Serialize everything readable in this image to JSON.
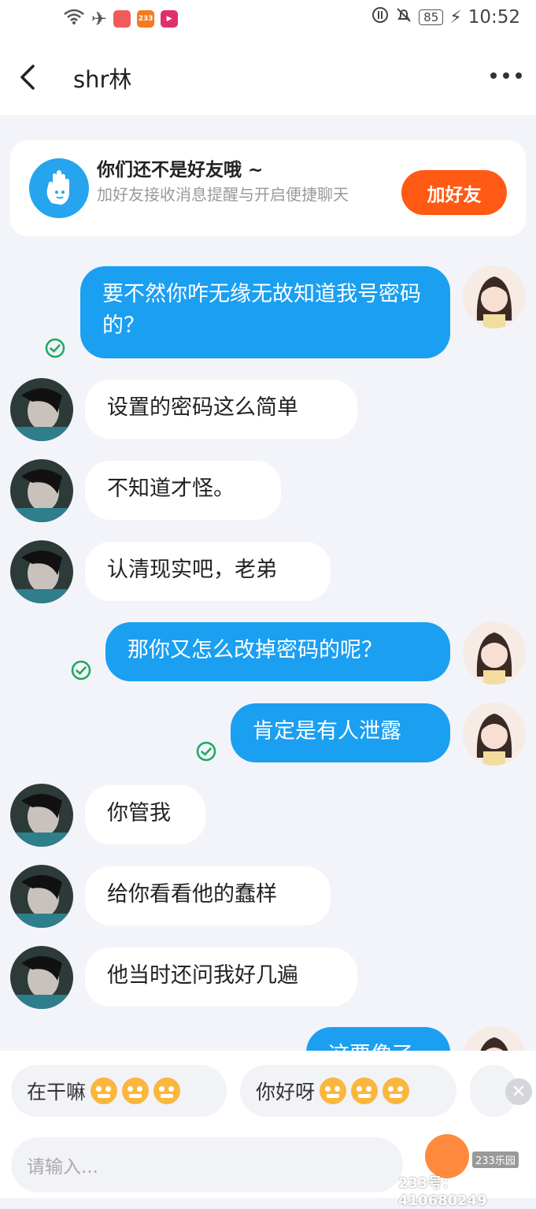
{
  "status_bar": {
    "battery": "85",
    "time": "10:52",
    "app_badge": "233"
  },
  "header": {
    "title": "shr林"
  },
  "friend_card": {
    "title": "你们还不是好友哦 ~",
    "subtitle": "加好友接收消息提醒与开启便捷聊天",
    "button": "加好友"
  },
  "messages": [
    {
      "from": "me",
      "text": "要不然你咋无缘无故知道我号密码的？",
      "read": true
    },
    {
      "from": "them",
      "text": "设置的密码这么简单"
    },
    {
      "from": "them",
      "text": "不知道才怪。"
    },
    {
      "from": "them",
      "text": "认清现实吧，老弟"
    },
    {
      "from": "me",
      "text": "那你又怎么改掉密码的呢？",
      "read": true
    },
    {
      "from": "me",
      "text": "肯定是有人泄露",
      "read": true
    },
    {
      "from": "them",
      "text": "你管我"
    },
    {
      "from": "them",
      "text": "给你看看他的蠢样"
    },
    {
      "from": "them",
      "text": "他当时还问我好几遍"
    },
    {
      "from": "me",
      "text": "这要像了",
      "read": false
    }
  ],
  "quick_replies": [
    {
      "text": "在干嘛",
      "emoji": "grin-emoji"
    },
    {
      "text": "你好呀",
      "emoji": "monkey-emoji"
    }
  ],
  "input": {
    "placeholder": "请输入..."
  },
  "watermark": "233号：410680249",
  "watermark_logo": "233乐园"
}
